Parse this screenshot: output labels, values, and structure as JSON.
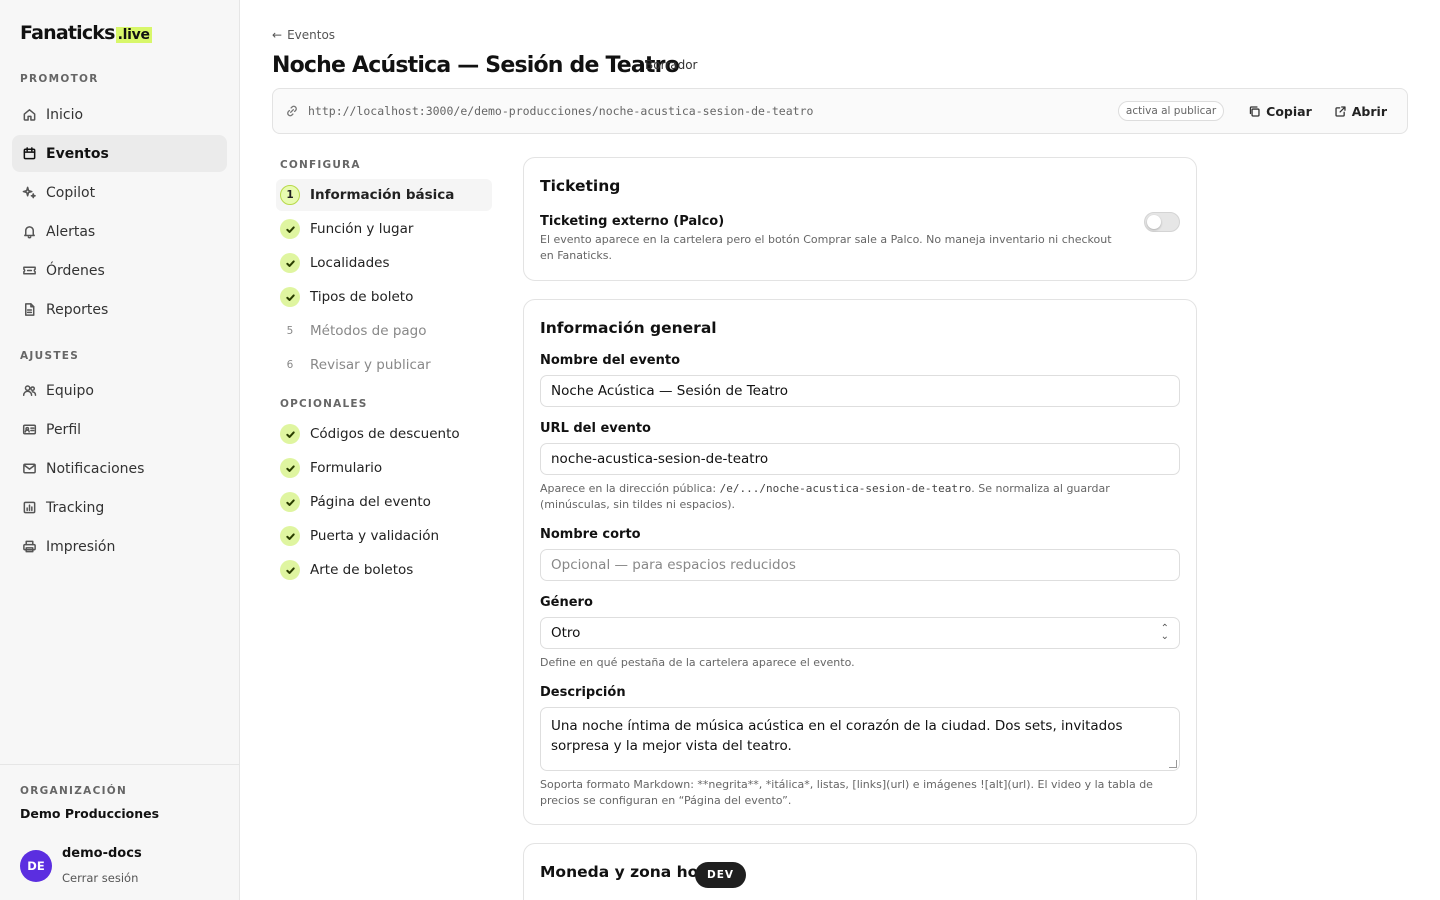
{
  "brand": {
    "name": "Fanaticks",
    "suffix": ".live",
    "accent": "#d8f76a"
  },
  "sidebar": {
    "promotor_label": "PROMOTOR",
    "promotor_items": [
      {
        "label": "Inicio",
        "icon": "home-icon"
      },
      {
        "label": "Eventos",
        "icon": "calendar-icon",
        "active": true
      },
      {
        "label": "Copilot",
        "icon": "sparkle-icon"
      },
      {
        "label": "Alertas",
        "icon": "bell-icon"
      },
      {
        "label": "Órdenes",
        "icon": "ticket-icon"
      },
      {
        "label": "Reportes",
        "icon": "file-icon"
      }
    ],
    "ajustes_label": "AJUSTES",
    "ajustes_items": [
      {
        "label": "Equipo",
        "icon": "users-icon"
      },
      {
        "label": "Perfil",
        "icon": "id-card-icon"
      },
      {
        "label": "Notificaciones",
        "icon": "mail-icon"
      },
      {
        "label": "Tracking",
        "icon": "chart-icon"
      },
      {
        "label": "Impresión",
        "icon": "printer-icon"
      }
    ],
    "org_label": "ORGANIZACIÓN",
    "org_name": "Demo Producciones",
    "user": {
      "initials": "DE",
      "name": "demo-docs",
      "logout": "Cerrar sesión",
      "avatar_color": "#5b2ee0"
    }
  },
  "header": {
    "back_label": "Eventos",
    "title": "Noche Acústica — Sesión de Teatro",
    "status": "Borrador",
    "url": "http://localhost:3000/e/demo-producciones/noche-acustica-sesion-de-teatro",
    "url_status": "activa al publicar",
    "copy_label": "Copiar",
    "open_label": "Abrir"
  },
  "steps": {
    "configura_label": "CONFIGURA",
    "configura": [
      {
        "marker": "1",
        "label": "Información básica",
        "state": "current"
      },
      {
        "marker": "",
        "label": "Función y lugar",
        "state": "done"
      },
      {
        "marker": "",
        "label": "Localidades",
        "state": "done"
      },
      {
        "marker": "",
        "label": "Tipos de boleto",
        "state": "done"
      },
      {
        "marker": "5",
        "label": "Métodos de pago",
        "state": "pending"
      },
      {
        "marker": "6",
        "label": "Revisar y publicar",
        "state": "pending"
      }
    ],
    "opcionales_label": "OPCIONALES",
    "opcionales": [
      {
        "label": "Códigos de descuento",
        "state": "done"
      },
      {
        "label": "Formulario",
        "state": "done"
      },
      {
        "label": "Página del evento",
        "state": "done"
      },
      {
        "label": "Puerta y validación",
        "state": "done"
      },
      {
        "label": "Arte de boletos",
        "state": "done"
      }
    ]
  },
  "ticketing": {
    "title": "Ticketing",
    "toggle_label": "Ticketing externo (Palco)",
    "toggle_help": "El evento aparece en la cartelera pero el botón Comprar sale a Palco. No maneja inventario ni checkout en Fanaticks.",
    "toggle_on": false
  },
  "general": {
    "title": "Información general",
    "name_label": "Nombre del evento",
    "name_value": "Noche Acústica — Sesión de Teatro",
    "url_label": "URL del evento",
    "url_value": "noche-acustica-sesion-de-teatro",
    "url_help_prefix": "Aparece en la dirección pública: ",
    "url_help_code": "/e/.../noche-acustica-sesion-de-teatro",
    "url_help_suffix": ". Se normaliza al guardar (minúsculas, sin tildes ni espacios).",
    "short_label": "Nombre corto",
    "short_placeholder": "Opcional — para espacios reducidos",
    "genre_label": "Género",
    "genre_value": "Otro",
    "genre_help": "Define en qué pestaña de la cartelera aparece el evento.",
    "desc_label": "Descripción",
    "desc_value": "Una noche íntima de música acústica en el corazón de la ciudad. Dos sets, invitados sorpresa y la mejor vista del teatro.",
    "desc_help": "Soporta formato Markdown: **negrita**, *itálica*, listas, [links](url) e imágenes ![alt](url). El video y la tabla de precios se configuran en “Página del evento”."
  },
  "currency": {
    "title": "Moneda y zona horaria"
  },
  "dev_badge": "DEV"
}
